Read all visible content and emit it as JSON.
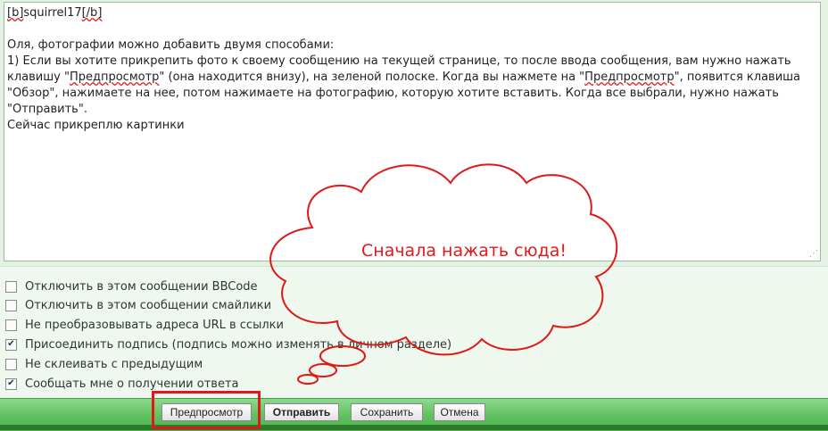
{
  "editor": {
    "lines": [
      "[b]squirrel17[/b]",
      "",
      "Оля, фотографии можно добавить двумя способами:",
      "1) Если вы хотите прикрепить фото к своему сообщению на текущей странице, то после ввода сообщения, вам нужно нажать",
      "клавишу \"Предпросмотр\" (она находится внизу), на зеленой полоске. Когда вы нажмете на \"Предпросмотр\", появится клавиша",
      "\"Обзор\", нажимаете на нее, потом нажимаете на фотографию, которую хотите вставить. Когда все выбрали, нужно нажать",
      "\"Отправить\".",
      "Сейчас прикреплю картинки"
    ]
  },
  "options": [
    {
      "label": "Отключить в этом сообщении BBCode",
      "checked": false
    },
    {
      "label": "Отключить в этом сообщении смайлики",
      "checked": false
    },
    {
      "label": "Не преобразовывать адреса URL в ссылки",
      "checked": false
    },
    {
      "label": "Присоединить подпись (подпись можно изменять в личном разделе)",
      "checked": true
    },
    {
      "label": "Не склеивать с предыдущим",
      "checked": false
    },
    {
      "label": "Сообщать мне о получении ответа",
      "checked": true
    }
  ],
  "buttons": {
    "preview": "Предпросмотр",
    "submit": "Отправить",
    "save": "Сохранить",
    "cancel": "Отмена"
  },
  "annotation": {
    "text": "Сначала нажать сюда!",
    "color": "#e01818"
  }
}
